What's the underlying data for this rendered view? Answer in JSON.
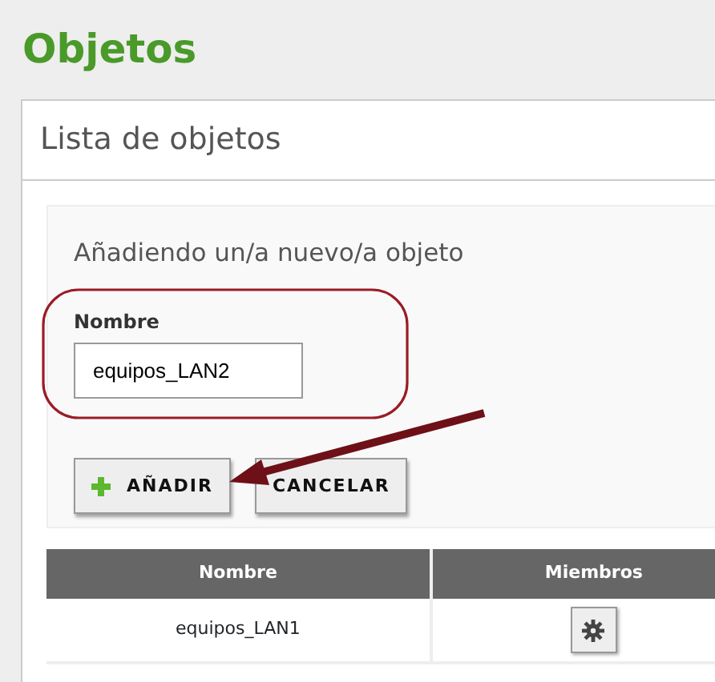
{
  "page_title": "Objetos",
  "panel": {
    "title": "Lista de objetos",
    "form": {
      "title": "Añadiendo un/a nuevo/a objeto",
      "field": {
        "label": "Nombre",
        "value": "equipos_LAN2"
      },
      "buttons": [
        {
          "kind": "add",
          "label": "AÑADIR"
        },
        {
          "kind": "cancel",
          "label": "CANCELAR"
        }
      ]
    },
    "table": {
      "columns": [
        "Nombre",
        "Miembros"
      ],
      "rows": [
        {
          "name": "equipos_LAN1",
          "members": {
            "kind": "gear"
          }
        }
      ]
    }
  }
}
